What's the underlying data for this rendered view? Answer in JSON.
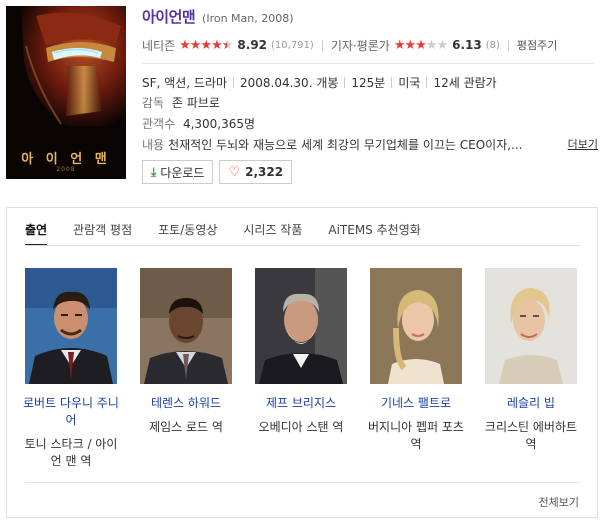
{
  "movie": {
    "title": "아이언맨",
    "subtitle": "(Iron Man, 2008)",
    "poster": {
      "title_text": "아 이 언 맨",
      "year_text": "2008"
    },
    "netizen": {
      "label": "네티즌",
      "stars": 4.5,
      "score": "8.92",
      "count": "(10,791)"
    },
    "critic": {
      "label": "기자·평론가",
      "stars": 3,
      "score": "6.13",
      "count": "(8)"
    },
    "my_rating_label": "평점주기",
    "meta": [
      "SF, 액션, 드라마",
      "2008.04.30. 개봉",
      "125분",
      "미국",
      "12세 관람가"
    ],
    "director": {
      "label": "감독",
      "name": "존 파브로"
    },
    "audience": {
      "label": "관객수",
      "value": "4,300,365명"
    },
    "summary": {
      "label": "내용",
      "text": "천재적인 두뇌와 재능으로 세계 최강의 무기업체를 이끄는 CEO이자,...",
      "more": "더보기"
    },
    "download_label": "다운로드",
    "like_count": "2,322"
  },
  "tabs": [
    {
      "label": "출연",
      "active": true
    },
    {
      "label": "관람객 평점",
      "active": false
    },
    {
      "label": "포토/동영상",
      "active": false
    },
    {
      "label": "시리즈 작품",
      "active": false
    },
    {
      "label": "AiTEMS 추천영화",
      "active": false
    }
  ],
  "cast": [
    {
      "name": "로버트 다우니 주니어",
      "role": "토니 스타크 / 아이언 맨 역"
    },
    {
      "name": "테렌스 하워드",
      "role": "제임스 로드 역"
    },
    {
      "name": "제프 브리지스",
      "role": "오베디아 스탠 역"
    },
    {
      "name": "기네스 팰트로",
      "role": "버지니아 펩퍼 포츠 역"
    },
    {
      "name": "레슬리 빕",
      "role": "크리스틴 에버하트 역"
    }
  ],
  "see_all_label": "전체보기",
  "colors": {
    "title": "#5a30a8",
    "star": "#e93b3b",
    "cast_name": "#1a3ea8"
  }
}
